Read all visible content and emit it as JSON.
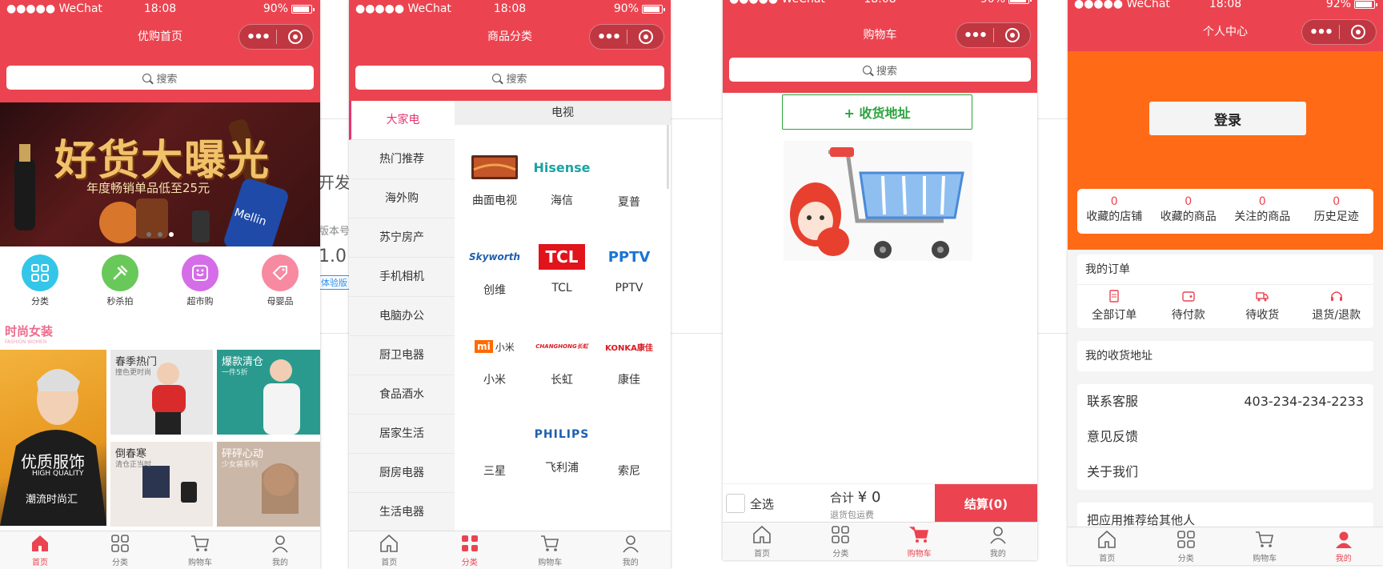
{
  "status": {
    "carrier": "●●●●● WeChat",
    "time": "18:08",
    "battery_1": "90%",
    "battery_4": "92%"
  },
  "capsule": {
    "dots": "•••"
  },
  "search": {
    "placeholder": "搜索"
  },
  "tabs": {
    "home": "首页",
    "category": "分类",
    "cart": "购物车",
    "me": "我的"
  },
  "background": {
    "title_fragment": "开发",
    "version_label": "版本号",
    "version": "1.0",
    "trial_badge": "体验版"
  },
  "home": {
    "title": "优购首页",
    "banner_title": "好货大曝光",
    "banner_sub": "年度畅销单品低至25元",
    "categories": [
      {
        "label": "分类",
        "color": "#33c6e8"
      },
      {
        "label": "秒杀拍",
        "color": "#69c85a"
      },
      {
        "label": "超市购",
        "color": "#d66de8"
      },
      {
        "label": "母婴品",
        "color": "#f78aa0"
      }
    ],
    "floor_title": "时尚女装",
    "floor_sub": "FASHION WOMEN",
    "tiles": [
      {
        "title": "优质服饰",
        "sub": "HIGH QUALITY",
        "sub2": "潮流时尚汇"
      },
      {
        "title": "春季热门",
        "sub": "撞色更时尚"
      },
      {
        "title": "爆款清仓",
        "sub": "一件5折"
      },
      {
        "title": "倒春寒",
        "sub": "清仓正当时"
      },
      {
        "title": "砰砰心动",
        "sub": "少女装系列"
      }
    ]
  },
  "category": {
    "title": "商品分类",
    "menu": [
      "大家电",
      "热门推荐",
      "海外购",
      "苏宁房产",
      "手机相机",
      "电脑办公",
      "厨卫电器",
      "食品酒水",
      "居家生活",
      "厨房电器",
      "生活电器"
    ],
    "subhead": "电视",
    "brands": [
      {
        "name": "曲面电视",
        "logo": ""
      },
      {
        "name": "海信",
        "logo": "Hisense"
      },
      {
        "name": "夏普",
        "logo": ""
      },
      {
        "name": "创维",
        "logo": "Skyworth"
      },
      {
        "name": "TCL",
        "logo": "TCL"
      },
      {
        "name": "PPTV",
        "logo": "PPTV"
      },
      {
        "name": "小米",
        "logo": "mi 小米"
      },
      {
        "name": "长虹",
        "logo": "CHANGHONG长虹"
      },
      {
        "name": "康佳",
        "logo": "KONKA康佳"
      },
      {
        "name": "三星",
        "logo": ""
      },
      {
        "name": "飞利浦",
        "logo": "PHILIPS"
      },
      {
        "name": "索尼",
        "logo": ""
      }
    ]
  },
  "cart": {
    "title": "购物车",
    "address_button": "+ 收货地址",
    "select_all": "全选",
    "total_label": "合计",
    "total_value": "¥ 0",
    "shipping_note": "退货包运费",
    "checkout": "结算(0)"
  },
  "profile": {
    "title": "个人中心",
    "login": "登录",
    "stats": [
      {
        "count": "0",
        "label": "收藏的店铺"
      },
      {
        "count": "0",
        "label": "收藏的商品"
      },
      {
        "count": "0",
        "label": "关注的商品"
      },
      {
        "count": "0",
        "label": "历史足迹"
      }
    ],
    "orders_title": "我的订单",
    "orders": [
      "全部订单",
      "待付款",
      "待收货",
      "退货/退款"
    ],
    "address_title": "我的收货地址",
    "service_label": "联系客服",
    "service_phone": "403-234-234-2233",
    "feedback": "意见反馈",
    "about": "关于我们",
    "recommend": "把应用推荐给其他人"
  },
  "colors": {
    "brand": "#eb4450",
    "orange": "#ff6a17",
    "green": "#2aa33c",
    "pink": "#e6356f"
  }
}
